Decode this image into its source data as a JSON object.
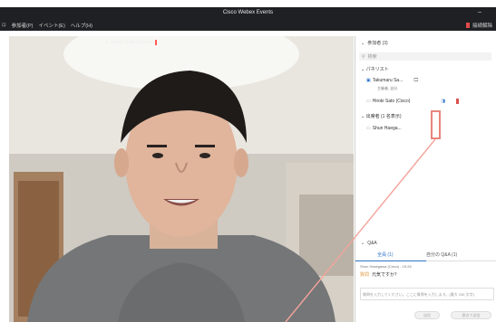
{
  "window": {
    "title": "Cisco Webex Events"
  },
  "menu": {
    "items": [
      "参加者(P)",
      "イベント(E)",
      "ヘルプ(H)"
    ],
    "right_label": "接続解除"
  },
  "video": {
    "presenter_label": "Hiroki Sato (Cisco)"
  },
  "participants": {
    "header": "参加者 (3)",
    "search_placeholder": "検索",
    "panelists_label": "パネリスト",
    "panelists": [
      {
        "name": "Takumaru Sa...",
        "sub": "主催者, 自分"
      },
      {
        "name": "Hiroki Sato (Cisco)"
      }
    ],
    "attendees_label": "出席者 (1 名表示)",
    "attendees": [
      {
        "name": "Shun Haega..."
      }
    ]
  },
  "qa": {
    "header": "Q&A",
    "tab_all": "全員 (1)",
    "tab_mine": "自分の Q&A (1)",
    "meta": "Shun Hasegawa (Cisco) - 15:26",
    "question_tag": "質問",
    "question_text": "元気ですか？",
    "input_placeholder": "質問を入力してください。ここに質問を入力します。(最大 256 文字)",
    "send_label": "送信",
    "anon_label": "匿名で送信"
  }
}
